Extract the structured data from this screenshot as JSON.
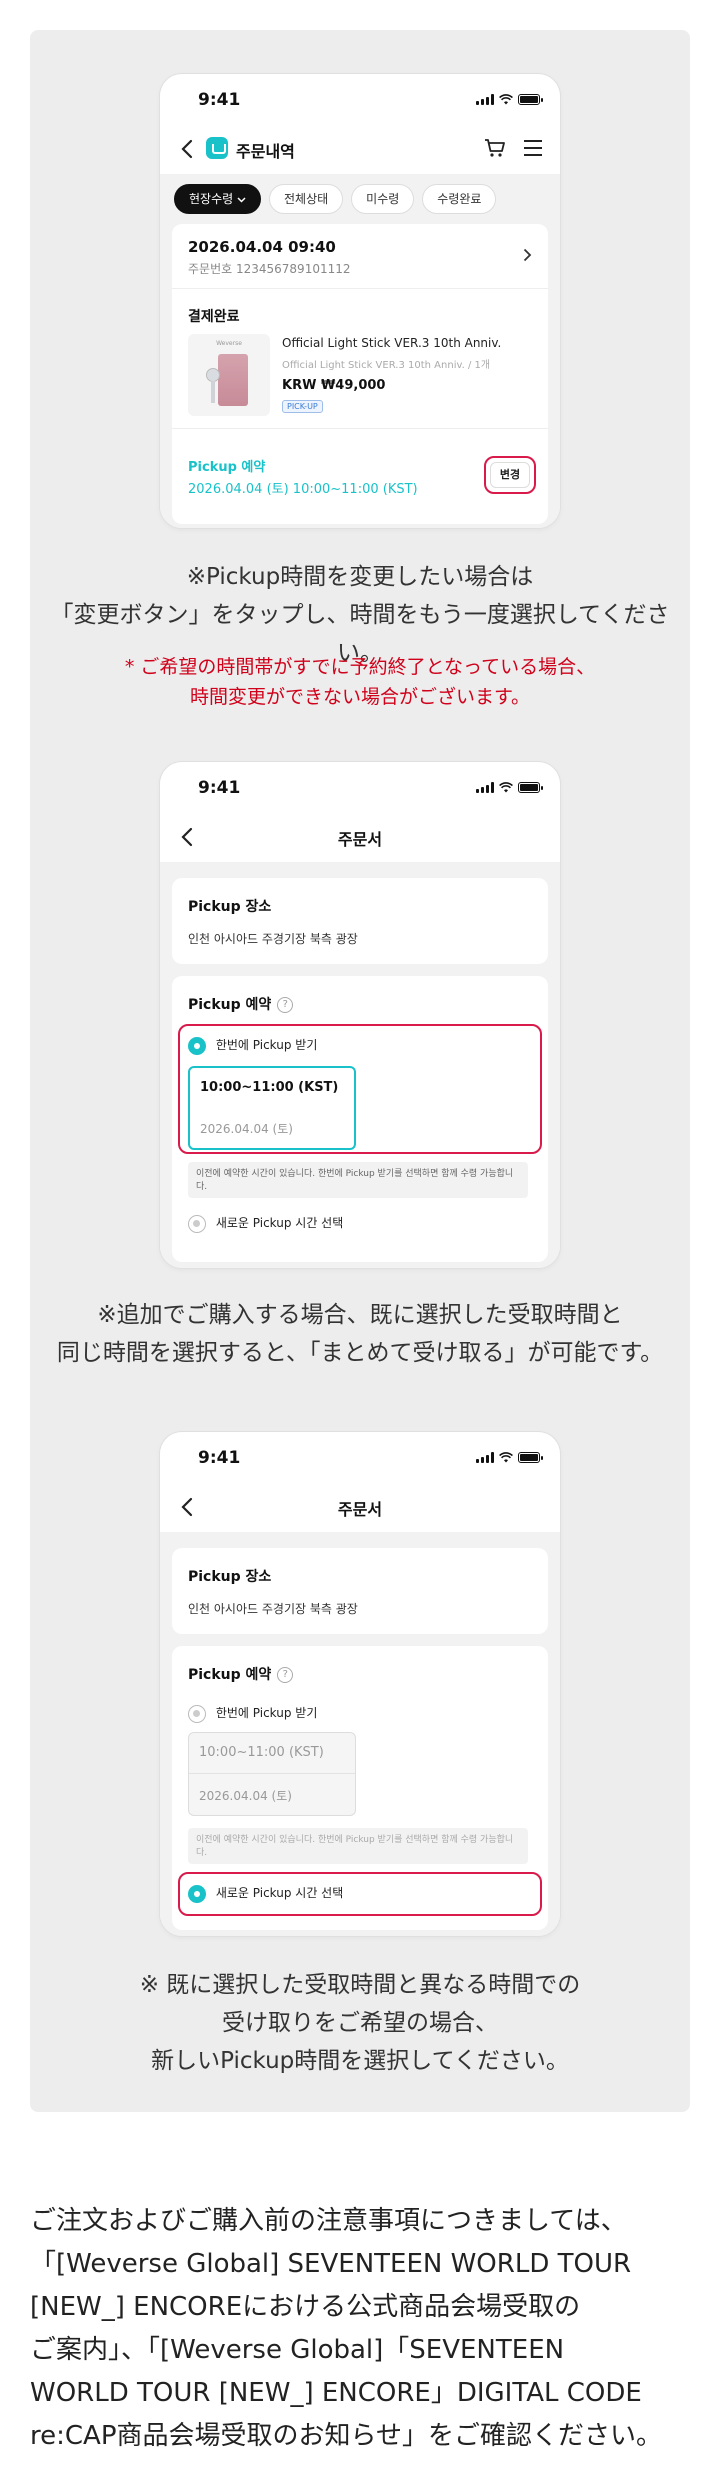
{
  "status_time": "9:41",
  "order_screen": {
    "title": "주문내역",
    "chips": [
      "현장수령",
      "전체상태",
      "미수령",
      "수령완료"
    ],
    "order_datetime": "2026.04.04 09:40",
    "order_number": "주문번호 123456789101112",
    "payment_status": "결제완료",
    "product_name": "Official Light Stick VER.3 10th Anniv.",
    "product_option": "Official Light Stick VER.3 10th Anniv. / 1개",
    "product_price": "KRW ₩49,000",
    "pickup_badge": "PICK-UP",
    "thumb_label": "Weverse",
    "reservation_label": "Pickup 예약",
    "reservation_time": "2026.04.04 (토) 10:00~11:00 (KST)",
    "change_button": "변경"
  },
  "caption_1": {
    "line1": "※Pickup時間を変更したい場合は",
    "line2": "「変更ボタン」をタップし、時間をもう一度選択してください。",
    "note1": "* ご希望の時間帯がすでに予約終了となっている場合、",
    "note2": "時間変更ができない場合がございます。"
  },
  "form_screen": {
    "title": "주문서",
    "pickup_place_title": "Pickup 장소",
    "pickup_place": "인천 아시아드 주경기장 북측 광장",
    "reservation_title": "Pickup 예약",
    "option_together": "한번에 Pickup 받기",
    "slot_time": "10:00~11:00 (KST)",
    "slot_date": "2026.04.04 (토)",
    "notice": "이전에 예약한 시간이 있습니다. 한번에 Pickup 받기를 선택하면 함께 수령 가능합니다.",
    "option_new": "새로운 Pickup 시간 선택"
  },
  "caption_2": {
    "line1": "※追加でご購入する場合、既に選択した受取時間と",
    "line2": "同じ時間を選択すると、「まとめて受け取る」が可能です。"
  },
  "caption_3": {
    "line1": "※ 既に選択した受取時間と異なる時間での",
    "line2": "受け取りをご希望の場合、",
    "line3": "新しいPickup時間を選択してください。"
  },
  "footer": {
    "line1": "ご注文およびご購入前の注意事項につきましては、",
    "line2": "「[Weverse Global] SEVENTEEN WORLD TOUR",
    "line3": "[NEW_] ENCOREにおける公式商品会場受取の",
    "line4": "ご案内」、「[Weverse Global]「SEVENTEEN",
    "line5": "WORLD TOUR [NEW_] ENCORE」DIGITAL CODE",
    "line6": "re:CAP商品会場受取のお知らせ」をご確認ください。"
  },
  "colors": {
    "accent": "#19c2c9",
    "highlight": "#d81b4a",
    "warning": "#d0021b",
    "panel": "#ededed"
  }
}
